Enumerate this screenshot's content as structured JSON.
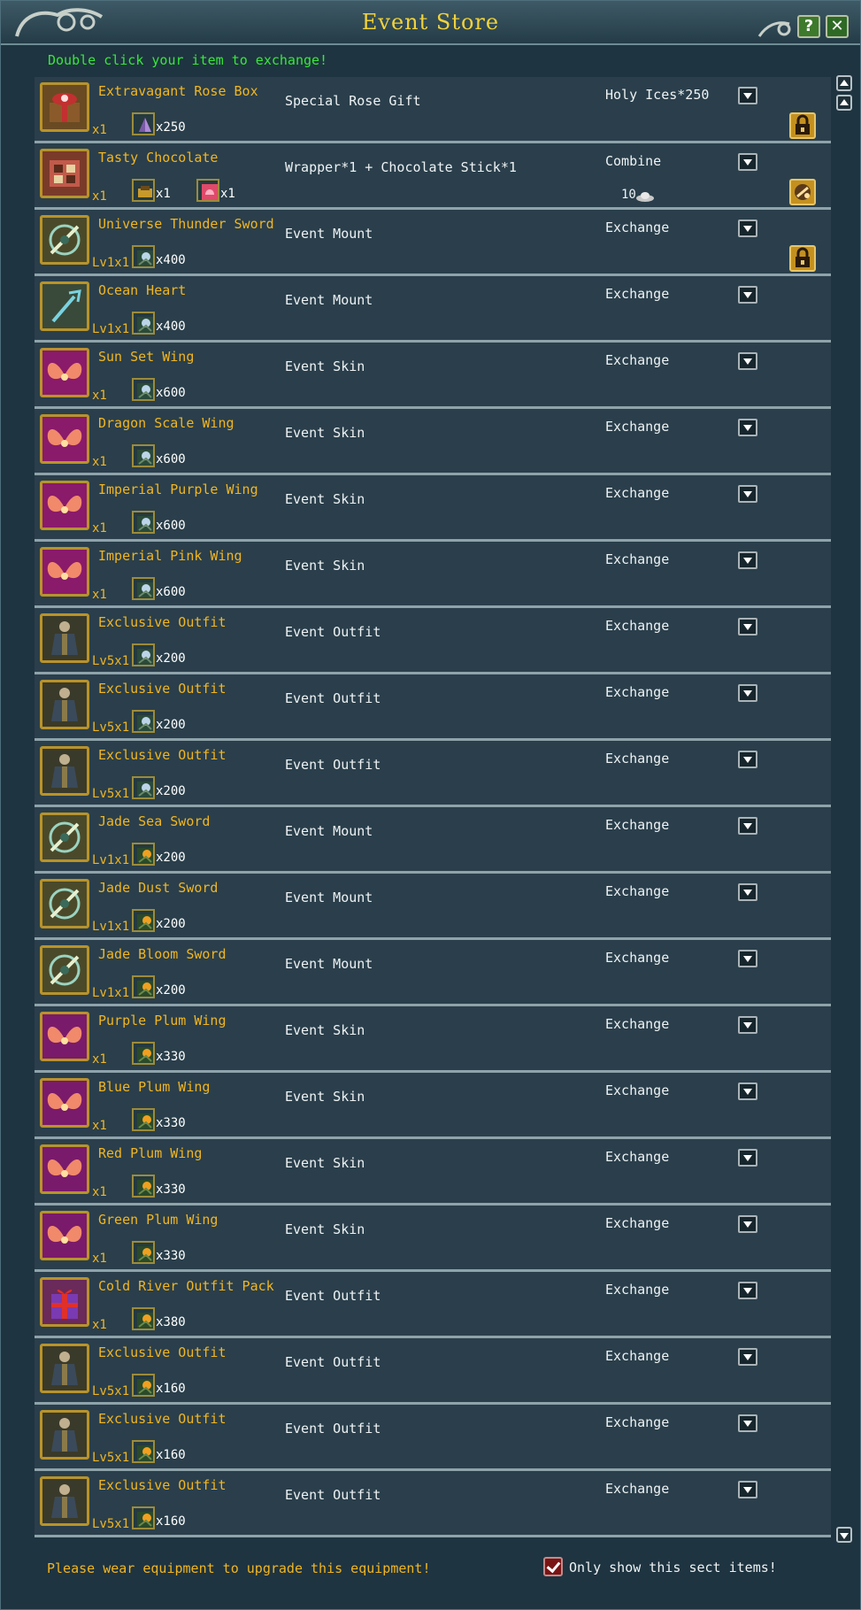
{
  "window": {
    "title": "Event Store",
    "hint": "Double click your item to exchange!",
    "footer_text": "Please wear equipment to upgrade this equipment!",
    "checkbox_label": "Only show this sect items!",
    "checkbox_checked": true
  },
  "items": [
    {
      "name": "Extravagant Rose Box",
      "level": "",
      "count": "x1",
      "desc": "Special Rose Gift",
      "action": "Holy Ices*250",
      "cost_icon": "crystal-icon",
      "cost_qty": "x250",
      "second_icon": "",
      "second_qty": "",
      "icon": "gift-box-icon",
      "bg": "#6a4a22",
      "side": "lock-icon",
      "sub_num": ""
    },
    {
      "name": "Tasty Chocolate",
      "level": "",
      "count": "x1",
      "desc": "Wrapper*1 + Chocolate Stick*1",
      "action": "Combine",
      "cost_icon": "wrapper-icon",
      "cost_qty": "x1",
      "second_icon": "chocolate-stick-icon",
      "second_qty": "x1",
      "icon": "chocolate-box-icon",
      "bg": "#7a3a2a",
      "side": "combine-icon",
      "sub_num": "10"
    },
    {
      "name": "Universe Thunder Sword",
      "level": "Lv1",
      "count": "x1",
      "desc": "Event Mount",
      "action": "Exchange",
      "cost_icon": "token-icon",
      "cost_qty": "x400",
      "second_icon": "",
      "second_qty": "",
      "icon": "sword-icon",
      "bg": "#4a4a2a",
      "side": "lock-icon",
      "sub_num": ""
    },
    {
      "name": "Ocean Heart",
      "level": "Lv1",
      "count": "x1",
      "desc": "Event Mount",
      "action": "Exchange",
      "cost_icon": "token-icon",
      "cost_qty": "x400",
      "second_icon": "",
      "second_qty": "",
      "icon": "trident-icon",
      "bg": "#3a4a3a",
      "side": "",
      "sub_num": ""
    },
    {
      "name": "Sun Set Wing",
      "level": "",
      "count": "x1",
      "desc": "Event Skin",
      "action": "Exchange",
      "cost_icon": "token-icon",
      "cost_qty": "x600",
      "second_icon": "",
      "second_qty": "",
      "icon": "wing-icon",
      "bg": "#8a1a6a",
      "side": "",
      "sub_num": ""
    },
    {
      "name": "Dragon Scale Wing",
      "level": "",
      "count": "x1",
      "desc": "Event Skin",
      "action": "Exchange",
      "cost_icon": "token-icon",
      "cost_qty": "x600",
      "second_icon": "",
      "second_qty": "",
      "icon": "wing-icon",
      "bg": "#8a1a6a",
      "side": "",
      "sub_num": ""
    },
    {
      "name": "Imperial Purple Wing",
      "level": "",
      "count": "x1",
      "desc": "Event Skin",
      "action": "Exchange",
      "cost_icon": "token-icon",
      "cost_qty": "x600",
      "second_icon": "",
      "second_qty": "",
      "icon": "wing-icon",
      "bg": "#8a1a6a",
      "side": "",
      "sub_num": ""
    },
    {
      "name": "Imperial Pink Wing",
      "level": "",
      "count": "x1",
      "desc": "Event Skin",
      "action": "Exchange",
      "cost_icon": "token-icon",
      "cost_qty": "x600",
      "second_icon": "",
      "second_qty": "",
      "icon": "wing-icon",
      "bg": "#8a1a6a",
      "side": "",
      "sub_num": ""
    },
    {
      "name": "Exclusive Outfit",
      "level": "Lv5",
      "count": "x1",
      "desc": "Event Outfit",
      "action": "Exchange",
      "cost_icon": "token-icon",
      "cost_qty": "x200",
      "second_icon": "",
      "second_qty": "",
      "icon": "outfit-icon",
      "bg": "#3a3a2a",
      "side": "",
      "sub_num": ""
    },
    {
      "name": "Exclusive Outfit",
      "level": "Lv5",
      "count": "x1",
      "desc": "Event Outfit",
      "action": "Exchange",
      "cost_icon": "token-icon",
      "cost_qty": "x200",
      "second_icon": "",
      "second_qty": "",
      "icon": "outfit-icon",
      "bg": "#3a3a2a",
      "side": "",
      "sub_num": ""
    },
    {
      "name": "Exclusive Outfit",
      "level": "Lv5",
      "count": "x1",
      "desc": "Event Outfit",
      "action": "Exchange",
      "cost_icon": "token-icon",
      "cost_qty": "x200",
      "second_icon": "",
      "second_qty": "",
      "icon": "outfit-icon",
      "bg": "#3a3a2a",
      "side": "",
      "sub_num": ""
    },
    {
      "name": "Jade Sea Sword",
      "level": "Lv1",
      "count": "x1",
      "desc": "Event Mount",
      "action": "Exchange",
      "cost_icon": "flower-token-icon",
      "cost_qty": "x200",
      "second_icon": "",
      "second_qty": "",
      "icon": "sword-icon",
      "bg": "#4a4a2a",
      "side": "",
      "sub_num": ""
    },
    {
      "name": "Jade Dust Sword",
      "level": "Lv1",
      "count": "x1",
      "desc": "Event Mount",
      "action": "Exchange",
      "cost_icon": "flower-token-icon",
      "cost_qty": "x200",
      "second_icon": "",
      "second_qty": "",
      "icon": "sword-icon",
      "bg": "#4a4a2a",
      "side": "",
      "sub_num": ""
    },
    {
      "name": "Jade Bloom Sword",
      "level": "Lv1",
      "count": "x1",
      "desc": "Event Mount",
      "action": "Exchange",
      "cost_icon": "flower-token-icon",
      "cost_qty": "x200",
      "second_icon": "",
      "second_qty": "",
      "icon": "sword-icon",
      "bg": "#4a4a2a",
      "side": "",
      "sub_num": ""
    },
    {
      "name": "Purple Plum Wing",
      "level": "",
      "count": "x1",
      "desc": "Event Skin",
      "action": "Exchange",
      "cost_icon": "flower-token-icon",
      "cost_qty": "x330",
      "second_icon": "",
      "second_qty": "",
      "icon": "wing-icon",
      "bg": "#7a1a6a",
      "side": "",
      "sub_num": ""
    },
    {
      "name": "Blue Plum Wing",
      "level": "",
      "count": "x1",
      "desc": "Event Skin",
      "action": "Exchange",
      "cost_icon": "flower-token-icon",
      "cost_qty": "x330",
      "second_icon": "",
      "second_qty": "",
      "icon": "wing-icon",
      "bg": "#7a1a6a",
      "side": "",
      "sub_num": ""
    },
    {
      "name": "Red Plum Wing",
      "level": "",
      "count": "x1",
      "desc": "Event Skin",
      "action": "Exchange",
      "cost_icon": "flower-token-icon",
      "cost_qty": "x330",
      "second_icon": "",
      "second_qty": "",
      "icon": "wing-icon",
      "bg": "#7a1a6a",
      "side": "",
      "sub_num": ""
    },
    {
      "name": "Green Plum Wing",
      "level": "",
      "count": "x1",
      "desc": "Event Skin",
      "action": "Exchange",
      "cost_icon": "flower-token-icon",
      "cost_qty": "x330",
      "second_icon": "",
      "second_qty": "",
      "icon": "wing-icon",
      "bg": "#7a1a6a",
      "side": "",
      "sub_num": ""
    },
    {
      "name": "Cold River Outfit Pack",
      "level": "",
      "count": "x1",
      "desc": "Event Outfit",
      "action": "Exchange",
      "cost_icon": "flower-token-icon",
      "cost_qty": "x380",
      "second_icon": "",
      "second_qty": "",
      "icon": "gift-pack-icon",
      "bg": "#6a2a5a",
      "side": "",
      "sub_num": ""
    },
    {
      "name": "Exclusive Outfit",
      "level": "Lv5",
      "count": "x1",
      "desc": "Event Outfit",
      "action": "Exchange",
      "cost_icon": "flower-token-icon",
      "cost_qty": "x160",
      "second_icon": "",
      "second_qty": "",
      "icon": "outfit-icon",
      "bg": "#3a3a2a",
      "side": "",
      "sub_num": ""
    },
    {
      "name": "Exclusive Outfit",
      "level": "Lv5",
      "count": "x1",
      "desc": "Event Outfit",
      "action": "Exchange",
      "cost_icon": "flower-token-icon",
      "cost_qty": "x160",
      "second_icon": "",
      "second_qty": "",
      "icon": "outfit-icon",
      "bg": "#3a3a2a",
      "side": "",
      "sub_num": ""
    },
    {
      "name": "Exclusive Outfit",
      "level": "Lv5",
      "count": "x1",
      "desc": "Event Outfit",
      "action": "Exchange",
      "cost_icon": "flower-token-icon",
      "cost_qty": "x160",
      "second_icon": "",
      "second_qty": "",
      "icon": "outfit-icon",
      "bg": "#3a3a2a",
      "side": "",
      "sub_num": ""
    }
  ],
  "colors": {
    "title": "#f2d23a",
    "hint": "#36e83a",
    "item_name": "#f2b521",
    "panel": "#2a3f4b"
  }
}
